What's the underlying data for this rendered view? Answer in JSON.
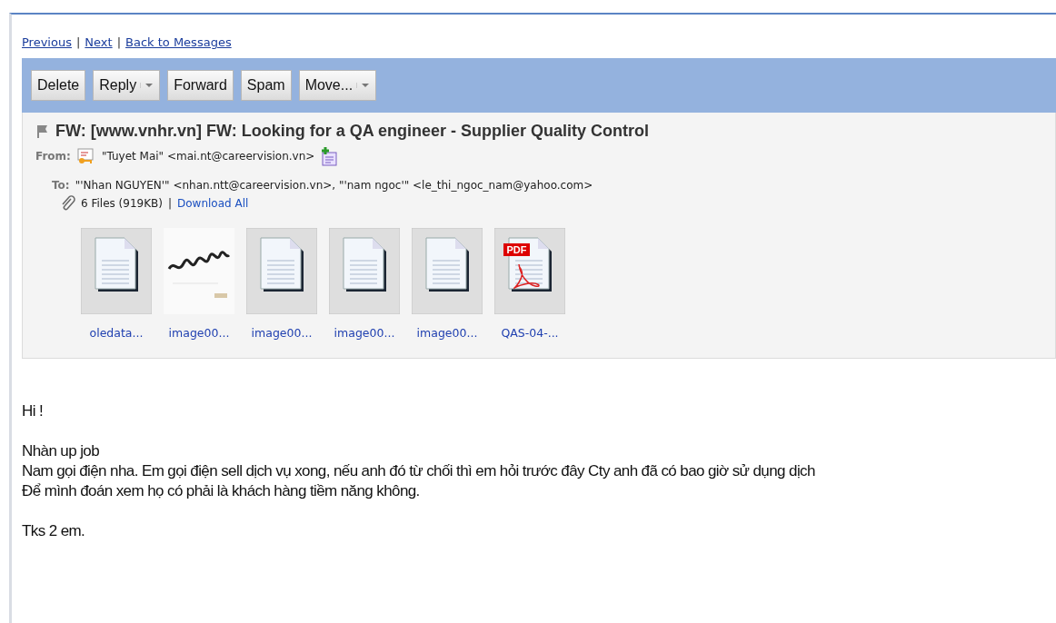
{
  "nav_links": [
    {
      "label": "Previous"
    },
    {
      "label": "Next"
    },
    {
      "label": "Back to Messages"
    }
  ],
  "nav_separator": "|",
  "toolbar": [
    {
      "label": "Delete",
      "dropdown": false
    },
    {
      "label": "Reply",
      "dropdown": true
    },
    {
      "label": "Forward",
      "dropdown": false
    },
    {
      "label": "Spam",
      "dropdown": false
    },
    {
      "label": "Move...",
      "dropdown": true
    }
  ],
  "message": {
    "subject": "FW: [www.vnhr.vn] FW: Looking for a QA engineer - Supplier Quality Control",
    "from_label": "From:",
    "from": "\"Tuyet Mai\" <mai.nt@careervision.vn>",
    "to_label": "To:",
    "to": "\"'Nhan NGUYEN'\" <nhan.ntt@careervision.vn>, \"'nam ngoc'\" <le_thi_ngoc_nam@yahoo.com>",
    "files_summary": "6 Files (919KB)",
    "files_separator": "|",
    "download_all": "Download All",
    "attachments": [
      {
        "kind": "doc",
        "name": "oledata..."
      },
      {
        "name": "image00..."
      },
      {
        "kind": "doc",
        "name": "image00..."
      },
      {
        "kind": "doc",
        "name": "image00..."
      },
      {
        "kind": "doc",
        "name": "image00..."
      },
      {
        "kind": "pdf",
        "name": "QAS-04-...",
        "badge": "PDF"
      }
    ]
  },
  "body": [
    {
      "lines": [
        "Hi !"
      ]
    },
    {
      "lines": [
        "Nhàn up job",
        "Nam gọi điện nha. Em gọi điện sell dịch vụ xong, nếu anh đó từ chối thì em hỏi trước đây Cty anh đã có bao giờ sử dụng dịch",
        "Để mình đoán xem họ có phải là khách hàng tiềm năng không."
      ]
    },
    {
      "lines": [
        "Tks 2 em."
      ]
    }
  ]
}
